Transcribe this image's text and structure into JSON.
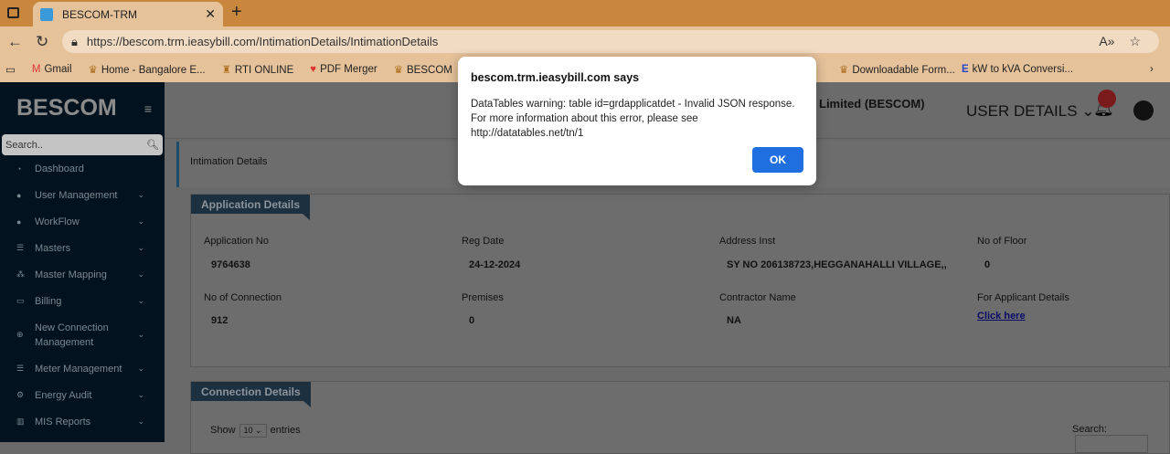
{
  "browser": {
    "tab_title": "BESCOM-TRM",
    "url": "https://bescom.trm.ieasybill.com/IntimationDetails/IntimationDetails",
    "bookmarks": [
      "Gmail",
      "Home - Bangalore E...",
      "RTI ONLINE",
      "PDF Merger",
      "BESCOM",
      "Downloadable Form...",
      "kW to kVA Conversi..."
    ]
  },
  "dialog": {
    "title": "bescom.trm.ieasybill.com says",
    "message": "DataTables warning: table id=grdapplicatdet - Invalid JSON response. For more information about this error, please see http://datatables.net/tn/1",
    "ok": "OK"
  },
  "sidebar": {
    "logo": "BESCOM",
    "search_placeholder": "Search..",
    "items": [
      {
        "label": "Dashboard"
      },
      {
        "label": "User Management"
      },
      {
        "label": "WorkFlow"
      },
      {
        "label": "Masters"
      },
      {
        "label": "Master Mapping"
      },
      {
        "label": "Billing"
      },
      {
        "label": "New Connection Management"
      },
      {
        "label": "Meter Management"
      },
      {
        "label": "Energy Audit"
      },
      {
        "label": "MIS Reports"
      }
    ]
  },
  "header": {
    "org": "Limited (BESCOM)",
    "user_details": "USER DETAILS"
  },
  "breadcrumb": "Intimation Details",
  "application": {
    "title": "Application Details",
    "fields": [
      {
        "label": "Application No",
        "value": "9764638"
      },
      {
        "label": "Reg Date",
        "value": "24-12-2024"
      },
      {
        "label": "Address Inst",
        "value": "SY NO 206138723,HEGGANAHALLI VILLAGE,,"
      },
      {
        "label": "No of Floor",
        "value": "0"
      },
      {
        "label": "No of Connection",
        "value": "912"
      },
      {
        "label": "Premises",
        "value": "0"
      },
      {
        "label": "Contractor Name",
        "value": "NA"
      },
      {
        "label": "For Applicant Details",
        "value": "Click here"
      }
    ]
  },
  "connection": {
    "title": "Connection Details",
    "show": "Show",
    "entries_value": "10",
    "entries": "entries",
    "search": "Search:"
  }
}
